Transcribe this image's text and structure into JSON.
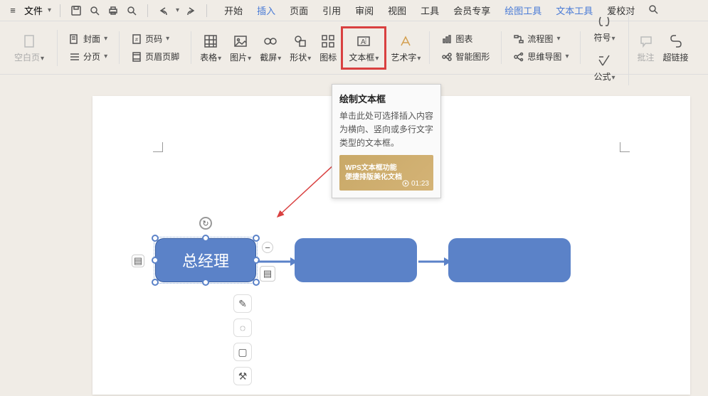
{
  "top": {
    "file_label": "文件"
  },
  "tabs": {
    "start": "开始",
    "insert": "插入",
    "page": "页面",
    "cite": "引用",
    "review": "审阅",
    "view": "视图",
    "tool": "工具",
    "member": "会员专享",
    "draw_tool": "绘图工具",
    "text_tool": "文本工具",
    "check": "爱校对"
  },
  "ribbon": {
    "blank_page": "空白页",
    "cover": "封面",
    "section": "分页",
    "page_num": "页码",
    "header_footer": "页眉页脚",
    "table": "表格",
    "picture": "图片",
    "screenshot": "截屏",
    "shape": "形状",
    "icon": "图标",
    "textbox": "文本框",
    "wordart": "艺术字",
    "chart": "图表",
    "smartart": "智能图形",
    "flowchart": "流程图",
    "mindmap": "思维导图",
    "symbol": "符号",
    "equation": "公式",
    "comment": "批注",
    "hyperlink": "超链接"
  },
  "tooltip": {
    "title": "绘制文本框",
    "body": "单击此处可选择插入内容为横向、竖向或多行文字类型的文本框。",
    "thumb_l1": "WPS文本框功能",
    "thumb_l2": "便捷排版美化文档",
    "thumb_time": "01:23"
  },
  "flow": {
    "shape1_text": "总经理"
  }
}
